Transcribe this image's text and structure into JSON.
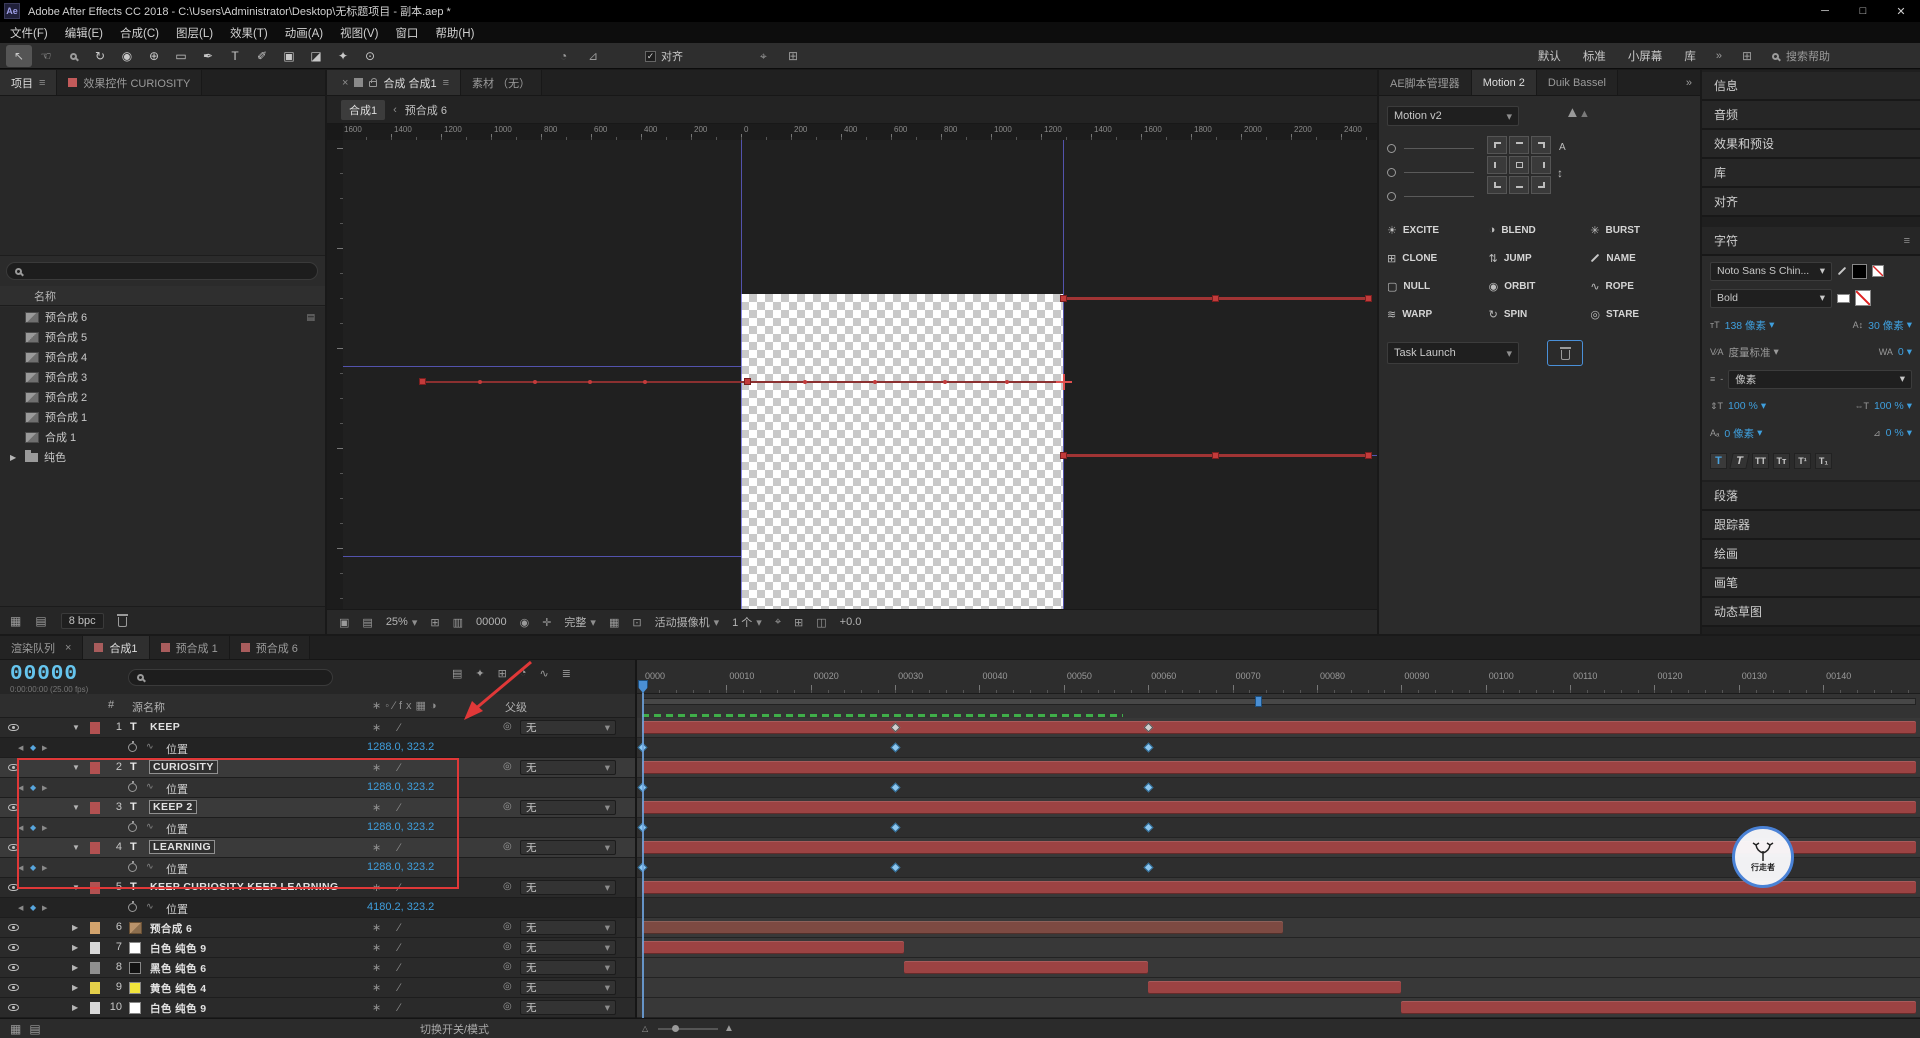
{
  "colors": {
    "accent_blue": "#3f9fdd",
    "timecode_cyan": "#66c5ee",
    "layer_bar_red": "#9c4343",
    "precomp_bar": "#7d4a42",
    "annotation_red": "#e03838",
    "guide_blue": "#6464dc",
    "workarea_green": "#3fae49"
  },
  "titlebar": {
    "app_icon": "Ae",
    "title": "Adobe After Effects CC 2018 - C:\\Users\\Administrator\\Desktop\\无标题项目 - 副本.aep *"
  },
  "menubar": [
    "文件(F)",
    "编辑(E)",
    "合成(C)",
    "图层(L)",
    "效果(T)",
    "动画(A)",
    "视图(V)",
    "窗口",
    "帮助(H)"
  ],
  "toolbar": {
    "tools": [
      {
        "name": "selection-tool",
        "selected": true
      },
      {
        "name": "hand-tool"
      },
      {
        "name": "zoom-tool"
      },
      {
        "name": "rotation-tool"
      },
      {
        "name": "camera-tool"
      },
      {
        "name": "pan-behind-tool"
      },
      {
        "name": "rectangle-tool"
      },
      {
        "name": "pen-tool"
      },
      {
        "name": "type-tool"
      },
      {
        "name": "brush-tool"
      },
      {
        "name": "clone-stamp-tool"
      },
      {
        "name": "eraser-tool"
      },
      {
        "name": "roto-brush-tool"
      },
      {
        "name": "puppet-pin-tool"
      }
    ],
    "snap_label": "对齐",
    "snap_checked": true,
    "workspaces": [
      "默认",
      "标准",
      "小屏幕",
      "库"
    ],
    "more_symbol": "»",
    "search_placeholder": "搜索帮助"
  },
  "project_panel": {
    "tabs": [
      {
        "label": "项目",
        "active": true
      },
      {
        "label": "效果控件 CURIOSITY",
        "active": false
      }
    ],
    "name_column": "名称",
    "items": [
      {
        "label": "预合成 6",
        "type": "comp"
      },
      {
        "label": "预合成 5",
        "type": "comp"
      },
      {
        "label": "预合成 4",
        "type": "comp"
      },
      {
        "label": "预合成 3",
        "type": "comp"
      },
      {
        "label": "预合成 2",
        "type": "comp"
      },
      {
        "label": "预合成 1",
        "type": "comp"
      },
      {
        "label": "合成 1",
        "type": "comp"
      },
      {
        "label": "纯色",
        "type": "folder"
      }
    ],
    "bpc": "8 bpc"
  },
  "comp_panel": {
    "tabs": [
      {
        "label": "合成 合成1",
        "active": true
      },
      {
        "label": "素材 （无）",
        "active": false
      }
    ],
    "breadcrumb": {
      "root": "合成1",
      "sep": "‹",
      "current": "预合成 6"
    },
    "ruler_labels": [
      "1600",
      "1400",
      "1200",
      "1000",
      "800",
      "600",
      "400",
      "200",
      "0",
      "200",
      "400",
      "600",
      "800",
      "1000",
      "1200",
      "1400",
      "1600",
      "1800",
      "2000",
      "2200",
      "2400"
    ],
    "footer": {
      "zoom": "25%",
      "frame": "00000",
      "resolution": "完整",
      "camera": "活动摄像机",
      "views": "1 个",
      "exposure": "+0.0"
    }
  },
  "scripts_panel": {
    "tabs": [
      {
        "label": "AE脚本管理器",
        "active": false
      },
      {
        "label": "Motion 2",
        "active": true
      },
      {
        "label": "Duik Bassel",
        "active": false
      }
    ],
    "overflow_symbol": "»",
    "preset_dropdown": "Motion v2",
    "buttons": [
      {
        "label": "EXCITE",
        "icon": "excite-icon"
      },
      {
        "label": "BLEND",
        "icon": "blend-icon"
      },
      {
        "label": "BURST",
        "icon": "burst-icon"
      },
      {
        "label": "CLONE",
        "icon": "clone-icon"
      },
      {
        "label": "JUMP",
        "icon": "jump-icon"
      },
      {
        "label": "NAME",
        "icon": "name-icon"
      },
      {
        "label": "NULL",
        "icon": "null-icon"
      },
      {
        "label": "ORBIT",
        "icon": "orbit-icon"
      },
      {
        "label": "ROPE",
        "icon": "rope-icon"
      },
      {
        "label": "WARP",
        "icon": "warp-icon"
      },
      {
        "label": "SPIN",
        "icon": "spin-icon"
      },
      {
        "label": "STARE",
        "icon": "stare-icon"
      }
    ],
    "task_dropdown": "Task Launch"
  },
  "right_panels": {
    "upper": [
      "信息",
      "音频",
      "效果和预设",
      "库",
      "对齐"
    ],
    "character": {
      "title": "字符",
      "font_family": "Noto Sans S Chin...",
      "font_style": "Bold",
      "font_size": "138 像素",
      "leading": "30 像素",
      "kerning": "度量标准",
      "tracking": "0",
      "unit": "像素",
      "vertical_scale": "100 %",
      "horizontal_scale": "100 %",
      "baseline_shift": "0 像素",
      "tsume": "0 %"
    },
    "lower": [
      "段落",
      "跟踪器",
      "绘画",
      "画笔",
      "动态草图"
    ]
  },
  "timeline": {
    "tabs": [
      {
        "label": "渲染队列",
        "active": false,
        "closable": true
      },
      {
        "label": "合成1",
        "active": true,
        "chip": true
      },
      {
        "label": "预合成 1",
        "active": false,
        "chip": true
      },
      {
        "label": "预合成 6",
        "active": false,
        "chip": true
      }
    ],
    "timecode": "00000",
    "timecode_sub": "0:00:00:00 (25.00 fps)",
    "columns": {
      "number": "#",
      "source_name": "源名称",
      "parent": "父级"
    },
    "ruler_labels": [
      "0000",
      "00010",
      "00020",
      "00030",
      "00040",
      "00050",
      "00060",
      "00070",
      "00080",
      "00090",
      "00100",
      "00110",
      "00120",
      "00130",
      "00140"
    ],
    "playhead_frame": 0,
    "work_area": {
      "start": 0,
      "end": 57
    },
    "marker_frame": 73,
    "layers": [
      {
        "num": "1",
        "type": "text",
        "name": "KEEP",
        "parent": "无",
        "expanded": true,
        "label_color": "#b25151",
        "bar_color": "#9c4343",
        "bar": {
          "s": 0,
          "e": 151
        },
        "row_keyframes": [
          30,
          60
        ],
        "prop": {
          "label": "位置",
          "value": "1288.0, 323.2",
          "keyframes": [
            0,
            30,
            60
          ]
        }
      },
      {
        "num": "2",
        "type": "text",
        "name": "CURIOSITY",
        "parent": "无",
        "selected": true,
        "expanded": true,
        "label_color": "#b25151",
        "bar_color": "#9c4343",
        "bar": {
          "s": 0,
          "e": 151
        },
        "prop": {
          "label": "位置",
          "value": "1288.0, 323.2",
          "keyframes": [
            0,
            30,
            60
          ]
        }
      },
      {
        "num": "3",
        "type": "text",
        "name": "KEEP 2",
        "parent": "无",
        "selected": true,
        "expanded": true,
        "label_color": "#b25151",
        "bar_color": "#9c4343",
        "bar": {
          "s": 0,
          "e": 151
        },
        "prop": {
          "label": "位置",
          "value": "1288.0, 323.2",
          "keyframes": [
            0,
            30,
            60
          ]
        }
      },
      {
        "num": "4",
        "type": "text",
        "name": "LEARNING",
        "parent": "无",
        "selected": true,
        "expanded": true,
        "label_color": "#b25151",
        "bar_color": "#9c4343",
        "bar": {
          "s": 0,
          "e": 151
        },
        "prop": {
          "label": "位置",
          "value": "1288.0, 323.2",
          "keyframes": [
            0,
            30,
            60
          ]
        }
      },
      {
        "num": "5",
        "type": "text",
        "name": "KEEP CURIOSITY KEEP LEARNING",
        "parent": "无",
        "expanded": true,
        "label_color": "#b25151",
        "bar_color": "#9c4343",
        "bar": {
          "s": 0,
          "e": 151
        },
        "prop": {
          "label": "位置",
          "value": "4180.2, 323.2",
          "keyframes": []
        }
      },
      {
        "num": "6",
        "type": "comp",
        "name": "预合成 6",
        "parent": "无",
        "label_color": "#d2a26c",
        "bar_color": "#7d4a42",
        "bar": {
          "s": 0,
          "e": 76
        }
      },
      {
        "num": "7",
        "type": "solid",
        "solid_color": "#ffffff",
        "name": "白色 纯色 9",
        "parent": "无",
        "label_color": "#d8d8d8",
        "bar_color": "#9c4343",
        "bar": {
          "s": 0,
          "e": 31
        }
      },
      {
        "num": "8",
        "type": "solid",
        "solid_color": "#111111",
        "name": "黑色 纯色 6",
        "parent": "无",
        "label_color": "#8f8f8f",
        "bar_color": "#9c4343",
        "bar": {
          "s": 31,
          "e": 60
        }
      },
      {
        "num": "9",
        "type": "solid",
        "solid_color": "#f0e43c",
        "name": "黄色 纯色 4",
        "parent": "无",
        "label_color": "#e3cf4a",
        "bar_color": "#9c4343",
        "bar": {
          "s": 60,
          "e": 90
        }
      },
      {
        "num": "10",
        "type": "solid",
        "solid_color": "#ffffff",
        "name": "白色 纯色 9",
        "parent": "无",
        "label_color": "#d8d8d8",
        "bar_color": "#9c4343",
        "bar": {
          "s": 90,
          "e": 151
        }
      }
    ],
    "statusbar": {
      "toggle_label": "切换开关/模式"
    }
  },
  "annotations": {
    "watermark_text": "行走者"
  }
}
